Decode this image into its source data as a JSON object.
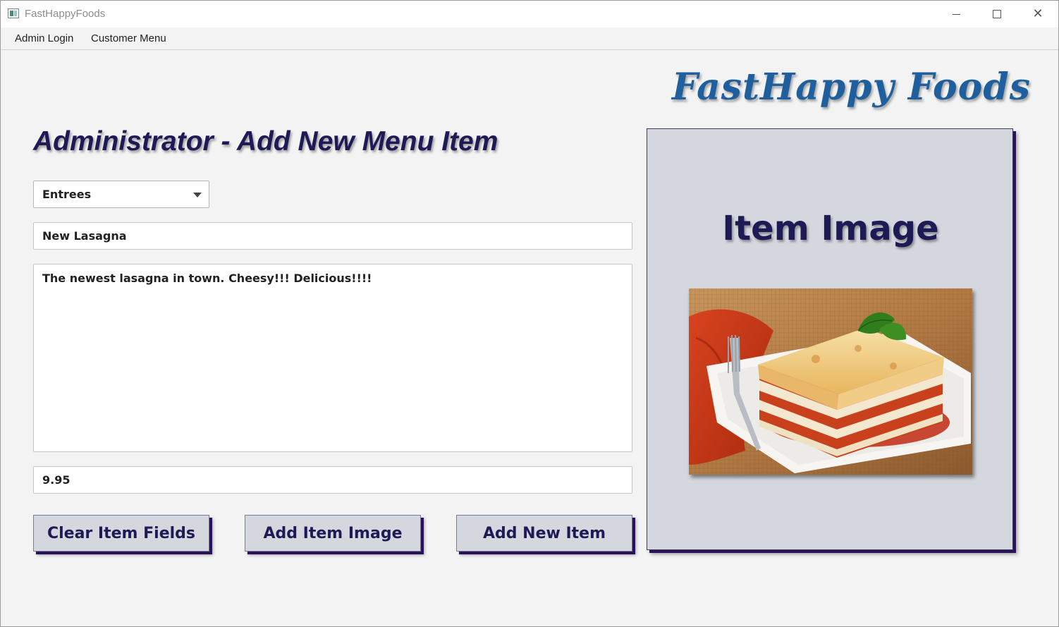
{
  "window": {
    "title": "FastHappyFoods",
    "controls": {
      "minimize": "minimize-icon",
      "maximize": "maximize-icon",
      "close": "close-icon"
    }
  },
  "menu": {
    "items": [
      {
        "label": "Admin Login"
      },
      {
        "label": "Customer Menu"
      }
    ]
  },
  "logo": {
    "text": "FastHappy Foods",
    "color": "#1f5f9e"
  },
  "page": {
    "heading": "Administrator - Add New Menu Item",
    "heading_color": "#1e1a55"
  },
  "form": {
    "category": {
      "selected": "Entrees"
    },
    "name": {
      "value": "New Lasagna"
    },
    "description": {
      "value": "The newest lasagna in town.  Cheesy!!! Delicious!!!!"
    },
    "price": {
      "value": "9.95"
    }
  },
  "buttons": {
    "clear": "Clear Item Fields",
    "add_image": "Add Item Image",
    "add_item": "Add New Item"
  },
  "image_panel": {
    "title": "Item Image",
    "photo_subject": "lasagna-on-plate-photo"
  },
  "colors": {
    "background": "#f3f3f3",
    "panel": "#d4d8de",
    "accent_shadow": "#2a1258",
    "text_dark": "#1e1a55"
  }
}
